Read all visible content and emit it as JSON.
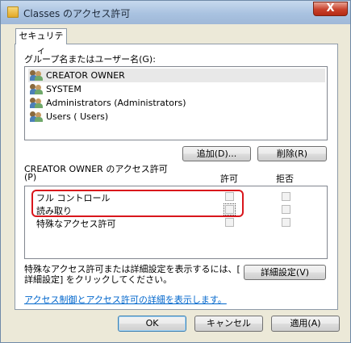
{
  "window": {
    "title": "Classes のアクセス許可",
    "close_label": "X"
  },
  "tab": {
    "label": "セキュリティ"
  },
  "group_list": {
    "label": "グループ名またはユーザー名(G):",
    "items": [
      {
        "name": "CREATOR OWNER",
        "selected": true
      },
      {
        "name": "SYSTEM",
        "selected": false
      },
      {
        "name": "Administrators (Administrators)",
        "selected": false
      },
      {
        "name": "Users ( Users)",
        "selected": false
      }
    ],
    "add_label": "追加(D)...",
    "remove_label": "削除(R)"
  },
  "permissions": {
    "label_line1": "CREATOR OWNER のアクセス許可",
    "label_line2": "(P)",
    "allow_header": "許可",
    "deny_header": "拒否",
    "items": [
      {
        "name": "フル コントロール",
        "allow": false,
        "deny": false
      },
      {
        "name": "読み取り",
        "allow": false,
        "deny": false
      },
      {
        "name": "特殊なアクセス許可",
        "allow": false,
        "deny": false
      }
    ]
  },
  "advanced": {
    "text_line1": "特殊なアクセス許可または詳細設定を表示するには、[",
    "text_line2": "詳細設定] をクリックしてください。",
    "button_label": "詳細設定(V)"
  },
  "help_link": "アクセス制御とアクセス許可の詳細を表示します。",
  "footer": {
    "ok_label": "OK",
    "cancel_label": "キャンセル",
    "apply_label": "適用(A)"
  },
  "colors": {
    "highlight": "#d9161c",
    "link": "#0066cc"
  }
}
